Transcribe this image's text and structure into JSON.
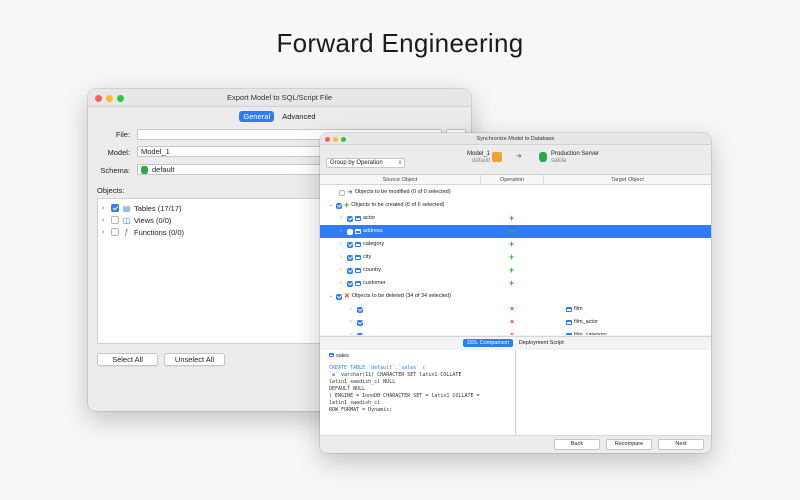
{
  "headline": "Forward Engineering",
  "colors": {
    "accent": "#2f7cf6",
    "close": "#ff5f57",
    "minimize": "#febc2e",
    "zoom": "#28c840",
    "add": "#34b233",
    "delete": "#d9352a"
  },
  "export_window": {
    "title": "Export Model to SQL/Script File",
    "tabs": [
      "General",
      "Advanced"
    ],
    "file_label": "File:",
    "file_value": "",
    "model_label": "Model:",
    "model_value": "Model_1",
    "schema_label": "Schema:",
    "schema_value": "default",
    "objects_label": "Objects:",
    "tree": [
      {
        "label": "Tables (17/17)",
        "checked": true,
        "icon": "table-icon"
      },
      {
        "label": "Views (0/0)",
        "checked": false,
        "icon": "view-icon"
      },
      {
        "label": "Functions (0/0)",
        "checked": false,
        "icon": "function-icon"
      }
    ],
    "select_all": "Select All",
    "unselect_all": "Unselect All"
  },
  "sync_window": {
    "title": "Synchronize Model to Database",
    "group_by": "Group by Operation",
    "source": {
      "name": "Model_1",
      "sub": "default"
    },
    "target": {
      "name": "Production Server",
      "sub": "sakila"
    },
    "columns": [
      "Source Object",
      "Operation",
      "Target Object"
    ],
    "rows": [
      {
        "label": "Objects to be modified (0 of 0 selected)",
        "kind": "group",
        "icon": "arrow",
        "checked": false,
        "expanded": false
      },
      {
        "label": "Objects to be created (6 of 6 selected)",
        "kind": "group",
        "icon": "plus",
        "checked": true,
        "expanded": true
      },
      {
        "label": "actor",
        "kind": "item",
        "op": "+",
        "target": ""
      },
      {
        "label": "address",
        "kind": "item",
        "op": "+",
        "target": "",
        "selected": true
      },
      {
        "label": "category",
        "kind": "item",
        "op": "+",
        "target": ""
      },
      {
        "label": "city",
        "kind": "item",
        "op": "+",
        "target": ""
      },
      {
        "label": "country",
        "kind": "item",
        "op": "+",
        "target": ""
      },
      {
        "label": "customer",
        "kind": "item",
        "op": "+",
        "target": ""
      },
      {
        "label": "Objects to be deleted (34 of 34 selected)",
        "kind": "group",
        "icon": "x",
        "checked": true,
        "expanded": true
      },
      {
        "label": "",
        "kind": "item",
        "op": "×",
        "target": "film"
      },
      {
        "label": "",
        "kind": "item",
        "op": "×",
        "target": "film_actor"
      },
      {
        "label": "",
        "kind": "item",
        "op": "×",
        "target": "film_category"
      }
    ],
    "bottom_tabs": [
      "DDL Comparison",
      "Deployment Script"
    ],
    "ddl_table": "sales",
    "ddl_lines": [
      "CREATE TABLE `default`.`sales` (",
      "  `a` varchar(11) CHARACTER SET latin1 COLLATE latin1_swedish_ci NULL",
      "DEFAULT NULL",
      ") ENGINE = InnoDB CHARACTER SET = latin1 COLLATE = latin1_swedish_ci",
      "ROW_FORMAT = Dynamic;"
    ],
    "buttons": {
      "back": "Back",
      "recompare": "Recompare",
      "next": "Next"
    }
  }
}
